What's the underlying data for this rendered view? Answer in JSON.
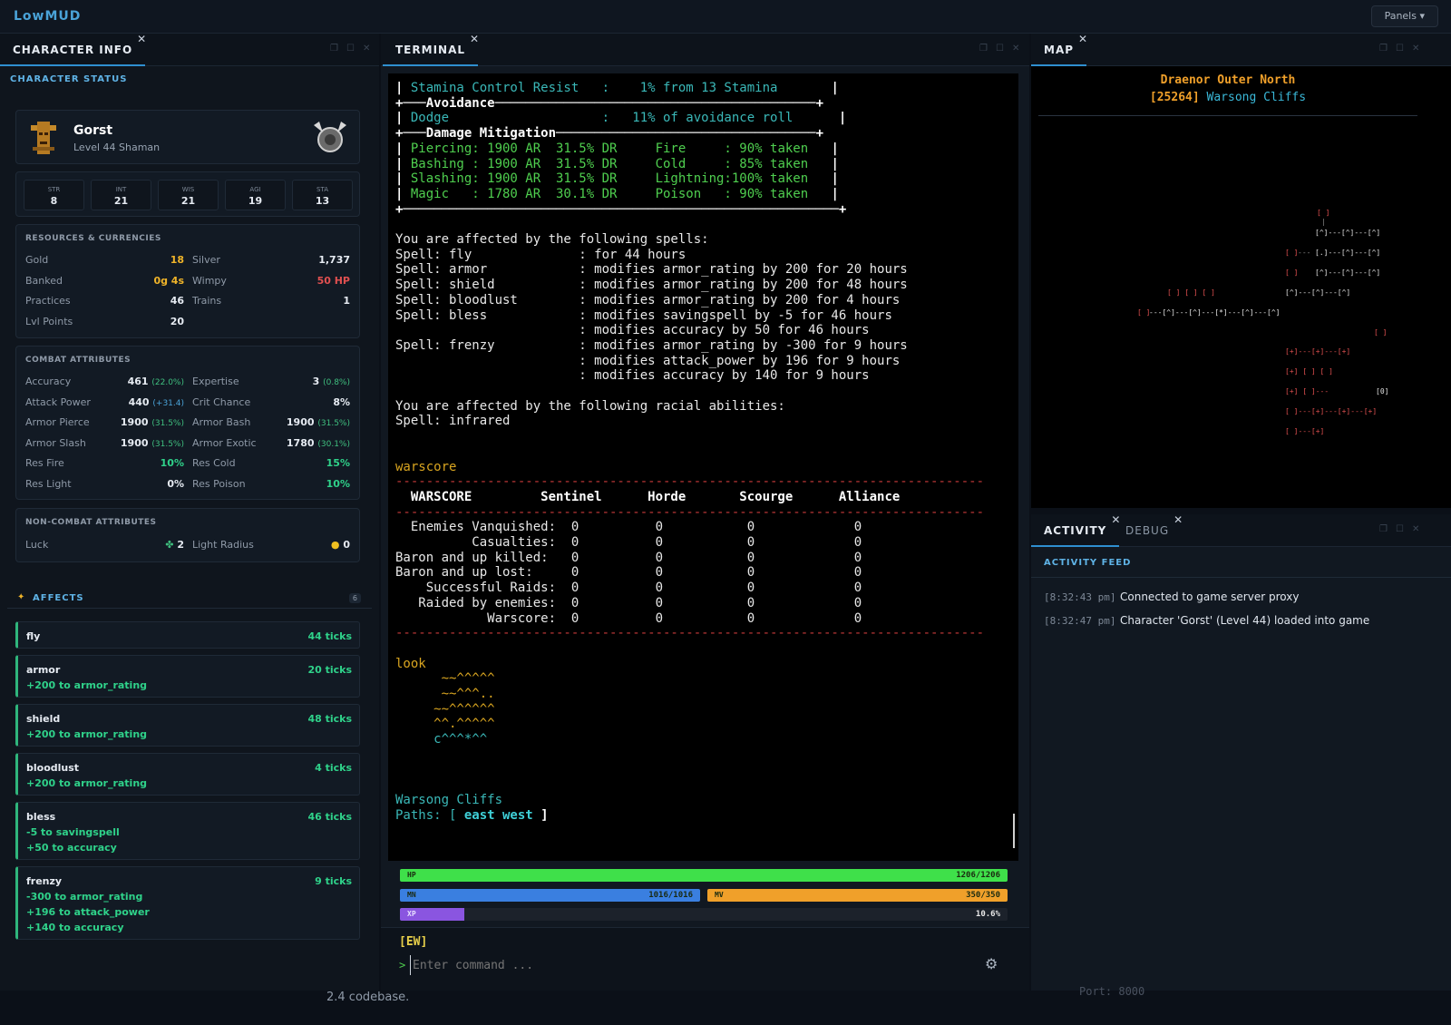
{
  "app": {
    "brand": "LowMUD",
    "panels_label": "Panels ▾"
  },
  "char_panel": {
    "tab": "CHARACTER INFO",
    "section": "CHARACTER STATUS",
    "name": "Gorst",
    "subtitle": "Level 44 Shaman",
    "stats": [
      {
        "label": "STR",
        "value": "8"
      },
      {
        "label": "INT",
        "value": "21"
      },
      {
        "label": "WIS",
        "value": "21"
      },
      {
        "label": "AGI",
        "value": "19"
      },
      {
        "label": "STA",
        "value": "13"
      }
    ],
    "resources": {
      "title": "RESOURCES & CURRENCIES",
      "rows": [
        {
          "l1": "Gold",
          "v1": "18",
          "l2": "Silver",
          "v2": "1,737"
        },
        {
          "l1": "Banked",
          "v1": "0g 4s",
          "l2": "Wimpy",
          "v2": "50 HP"
        },
        {
          "l1": "Practices",
          "v1": "46",
          "l2": "Trains",
          "v2": "1"
        },
        {
          "l1": "Lvl Points",
          "v1": "20",
          "l2": "",
          "v2": ""
        }
      ]
    },
    "combat": {
      "title": "COMBAT ATTRIBUTES",
      "rows": [
        {
          "l1": "Accuracy",
          "v1": "461",
          "s1": "(22.0%)",
          "l2": "Expertise",
          "v2": "3",
          "s2": "(0.8%)"
        },
        {
          "l1": "Attack Power",
          "v1": "440",
          "s1": "(+31.4)",
          "l2": "Crit Chance",
          "v2": "8%",
          "s2": ""
        },
        {
          "l1": "Armor Pierce",
          "v1": "1900",
          "s1": "(31.5%)",
          "l2": "Armor Bash",
          "v2": "1900",
          "s2": "(31.5%)"
        },
        {
          "l1": "Armor Slash",
          "v1": "1900",
          "s1": "(31.5%)",
          "l2": "Armor Exotic",
          "v2": "1780",
          "s2": "(30.1%)"
        },
        {
          "l1": "Res Fire",
          "v1": "10%",
          "s1": "",
          "l2": "Res Cold",
          "v2": "15%",
          "s2": ""
        },
        {
          "l1": "Res Light",
          "v1": "0%",
          "s1": "",
          "l2": "Res Poison",
          "v2": "10%",
          "s2": ""
        }
      ]
    },
    "noncombat": {
      "title": "NON-COMBAT ATTRIBUTES",
      "luck_label": "Luck",
      "luck_value": "2",
      "light_label": "Light Radius",
      "light_value": "0"
    },
    "affects": {
      "title": "AFFECTS",
      "count": "6",
      "items": [
        {
          "name": "fly",
          "ticks": "44 ticks",
          "mods": []
        },
        {
          "name": "armor",
          "ticks": "20 ticks",
          "mods": [
            "+200 to armor_rating"
          ]
        },
        {
          "name": "shield",
          "ticks": "48 ticks",
          "mods": [
            "+200 to armor_rating"
          ]
        },
        {
          "name": "bloodlust",
          "ticks": "4 ticks",
          "mods": [
            "+200 to armor_rating"
          ]
        },
        {
          "name": "bless",
          "ticks": "46 ticks",
          "mods": [
            "-5 to savingspell",
            "+50 to accuracy"
          ]
        },
        {
          "name": "frenzy",
          "ticks": "9 ticks",
          "mods": [
            "-300 to armor_rating",
            "+196 to attack_power",
            "+140 to accuracy"
          ]
        }
      ]
    }
  },
  "terminal": {
    "tab": "TERMINAL",
    "lines": [
      [
        {
          "t": "| ",
          "c": "w"
        },
        {
          "t": "Stamina Control Resist   :    1% from 13 Stamina       ",
          "c": "c"
        },
        {
          "t": "|",
          "c": "w"
        }
      ],
      [
        {
          "t": "+───",
          "c": "w"
        },
        {
          "t": "Avoidance",
          "c": "w"
        },
        {
          "t": "──────────────────────────────────────────+",
          "c": "w"
        }
      ],
      [
        {
          "t": "| ",
          "c": "w"
        },
        {
          "t": "Dodge                    :   11% of avoidance roll      ",
          "c": "c"
        },
        {
          "t": "|",
          "c": "w"
        }
      ],
      [
        {
          "t": "+───",
          "c": "w"
        },
        {
          "t": "Damage Mitigation",
          "c": "w"
        },
        {
          "t": "──────────────────────────────────+",
          "c": "w"
        }
      ],
      [
        {
          "t": "| ",
          "c": "w"
        },
        {
          "t": "Piercing: 1900 AR  31.5% DR     Fire     : 90% taken   ",
          "c": "g"
        },
        {
          "t": "|",
          "c": "w"
        }
      ],
      [
        {
          "t": "| ",
          "c": "w"
        },
        {
          "t": "Bashing : 1900 AR  31.5% DR     Cold     : 85% taken   ",
          "c": "g"
        },
        {
          "t": "|",
          "c": "w"
        }
      ],
      [
        {
          "t": "| ",
          "c": "w"
        },
        {
          "t": "Slashing: 1900 AR  31.5% DR     Lightning:100% taken   ",
          "c": "g"
        },
        {
          "t": "|",
          "c": "w"
        }
      ],
      [
        {
          "t": "| ",
          "c": "w"
        },
        {
          "t": "Magic   : 1780 AR  30.1% DR     Poison   : 90% taken   ",
          "c": "g"
        },
        {
          "t": "|",
          "c": "w"
        }
      ],
      [
        {
          "t": "+─────────────────────────────────────────────────────────+",
          "c": "w"
        }
      ],
      [
        {
          "t": "",
          "c": ""
        }
      ],
      [
        {
          "t": "You are affected by the following spells:",
          "c": ""
        }
      ],
      [
        {
          "t": "Spell: fly              : for 44 hours",
          "c": ""
        }
      ],
      [
        {
          "t": "Spell: armor            : modifies armor_rating by 200 for 20 hours",
          "c": ""
        }
      ],
      [
        {
          "t": "Spell: shield           : modifies armor_rating by 200 for 48 hours",
          "c": ""
        }
      ],
      [
        {
          "t": "Spell: bloodlust        : modifies armor_rating by 200 for 4 hours",
          "c": ""
        }
      ],
      [
        {
          "t": "Spell: bless            : modifies savingspell by -5 for 46 hours",
          "c": ""
        }
      ],
      [
        {
          "t": "                        : modifies accuracy by 50 for 46 hours",
          "c": ""
        }
      ],
      [
        {
          "t": "Spell: frenzy           : modifies armor_rating by -300 for 9 hours",
          "c": ""
        }
      ],
      [
        {
          "t": "                        : modifies attack_power by 196 for 9 hours",
          "c": ""
        }
      ],
      [
        {
          "t": "                        : modifies accuracy by 140 for 9 hours",
          "c": ""
        }
      ],
      [
        {
          "t": "",
          "c": ""
        }
      ],
      [
        {
          "t": "You are affected by the following racial abilities:",
          "c": ""
        }
      ],
      [
        {
          "t": "Spell: infrared",
          "c": ""
        }
      ],
      [
        {
          "t": "",
          "c": ""
        }
      ],
      [
        {
          "t": "",
          "c": ""
        }
      ],
      [
        {
          "t": "warscore",
          "c": "y"
        }
      ],
      [
        {
          "t": "-----------------------------------------------------------------------------",
          "c": "r"
        }
      ],
      [
        {
          "t": "  WARSCORE         Sentinel      Horde       Scourge      Alliance",
          "c": "w"
        }
      ],
      [
        {
          "t": "-----------------------------------------------------------------------------",
          "c": "r"
        }
      ],
      [
        {
          "t": "  Enemies Vanquished:  0          0           0             0",
          "c": ""
        }
      ],
      [
        {
          "t": "          Casualties:  0          0           0             0",
          "c": ""
        }
      ],
      [
        {
          "t": "Baron and up killed:   0          0           0             0",
          "c": ""
        }
      ],
      [
        {
          "t": "Baron and up lost:     0          0           0             0",
          "c": ""
        }
      ],
      [
        {
          "t": "    Successful Raids:  0          0           0             0",
          "c": ""
        }
      ],
      [
        {
          "t": "   Raided by enemies:  0          0           0             0",
          "c": ""
        }
      ],
      [
        {
          "t": "            Warscore:  0          0           0             0",
          "c": ""
        }
      ],
      [
        {
          "t": "-----------------------------------------------------------------------------",
          "c": "r"
        }
      ],
      [
        {
          "t": "",
          "c": ""
        }
      ],
      [
        {
          "t": "look",
          "c": "y"
        }
      ],
      [
        {
          "t": "      ~~^^^^^",
          "c": "y"
        }
      ],
      [
        {
          "t": "      ~~^^^..",
          "c": "y"
        }
      ],
      [
        {
          "t": "     ~~^^^^^^",
          "c": "y"
        }
      ],
      [
        {
          "t": "     ^^.^^^^^",
          "c": "y"
        }
      ],
      [
        {
          "t": "     c^^^*^^",
          "c": "c"
        }
      ],
      [
        {
          "t": "",
          "c": ""
        }
      ],
      [
        {
          "t": "",
          "c": ""
        }
      ],
      [
        {
          "t": "",
          "c": ""
        }
      ],
      [
        {
          "t": "Warsong Cliffs",
          "c": "c"
        }
      ],
      [
        {
          "t": "Paths: [ ",
          "c": "c"
        },
        {
          "t": "east west",
          "c": "cy"
        },
        {
          "t": " ]",
          "c": "w"
        }
      ]
    ],
    "bars": {
      "hp": {
        "label": "HP",
        "value": "1206/1206",
        "frac": 1.0,
        "color": "#3fe04a"
      },
      "mn": {
        "label": "MN",
        "value": "1016/1016",
        "frac": 1.0,
        "color": "#3a7fe0"
      },
      "mv": {
        "label": "MV",
        "value": "350/350",
        "frac": 1.0,
        "color": "#f0a02a"
      },
      "xp": {
        "label": "XP",
        "value": "10.6%",
        "frac": 0.106,
        "color": "#8a55e0"
      }
    },
    "prompt": "[EW]",
    "caret": ">",
    "input_placeholder": "Enter command ..."
  },
  "map": {
    "tab": "MAP",
    "area": "Draenor Outer North",
    "room_id": "[25264]",
    "room_name": "Warsong Cliffs"
  },
  "activity": {
    "tabs": [
      "ACTIVITY",
      "DEBUG"
    ],
    "feed_title": "ACTIVITY FEED",
    "entries": [
      {
        "time": "[8:32:43 pm]",
        "text": "Connected to game server proxy"
      },
      {
        "time": "[8:32:47 pm]",
        "text": "Character 'Gorst' (Level 44) loaded into game"
      }
    ]
  },
  "background_text": {
    "left": "2.4 codebase.",
    "right": "Port: 8000"
  },
  "colors": {
    "accent": "#2f8fd0",
    "heal": "#2fd28a",
    "gold": "#f0b429",
    "danger": "#e05050"
  }
}
